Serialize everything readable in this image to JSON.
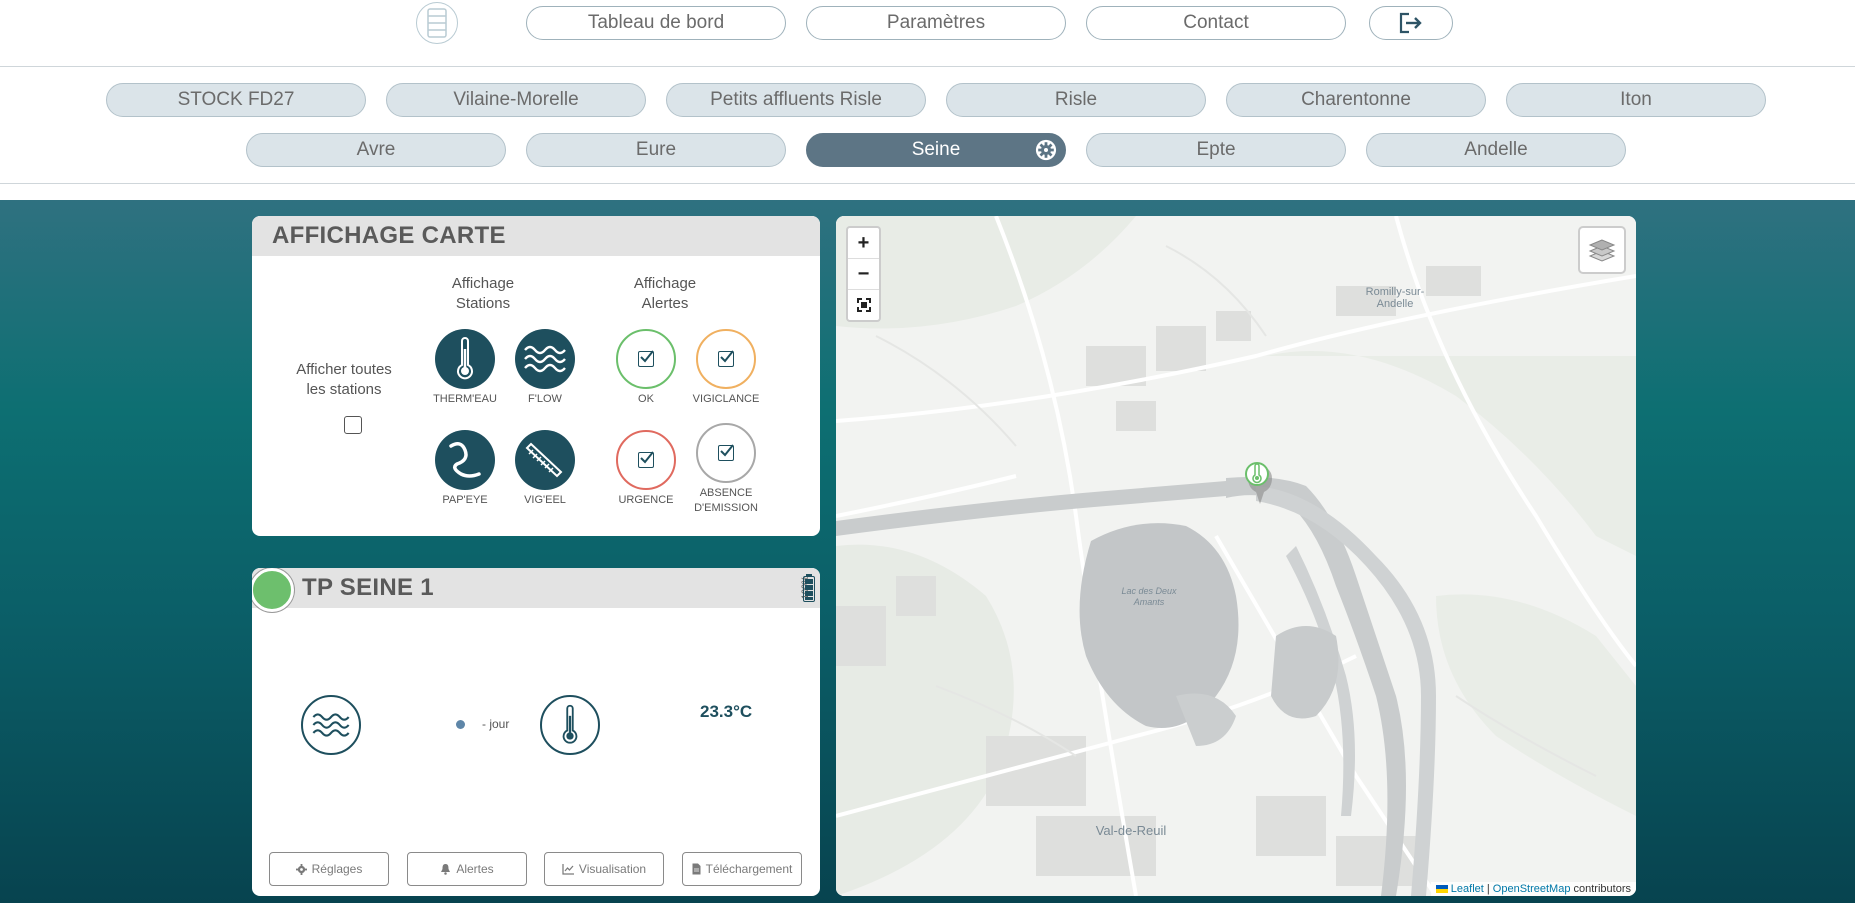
{
  "nav": {
    "dashboard": "Tableau de bord",
    "settings": "Paramètres",
    "contact": "Contact"
  },
  "rivers": {
    "row1": [
      "STOCK FD27",
      "Vilaine-Morelle",
      "Petits affluents Risle",
      "Risle",
      "Charentonne",
      "Iton"
    ],
    "row2": [
      "Avre",
      "Eure",
      "Seine",
      "Epte",
      "Andelle"
    ],
    "active": "Seine"
  },
  "display_panel": {
    "title": "AFFICHAGE CARTE",
    "show_all_label": "Afficher toutes les stations",
    "stations_header": "Affichage Stations",
    "alerts_header": "Affichage Alertes",
    "stations": [
      "THERM'EAU",
      "F'LOW",
      "PAP'EYE",
      "VIG'EEL"
    ],
    "alerts": [
      "OK",
      "VIGICLANCE",
      "URGENCE",
      "ABSENCE D'EMISSION"
    ],
    "alert_colors": {
      "ok": "#6bbf6b",
      "vigilance": "#f0b060",
      "urgence": "#e06a5f",
      "absence": "#a8a8a8"
    }
  },
  "station_panel": {
    "name": "TP SEINE 1",
    "battery": "100%",
    "status_color": "#6dbf6d",
    "flow_text": "- jour",
    "temperature": "23.3°C",
    "buttons": {
      "settings": "Réglages",
      "alerts": "Alertes",
      "visualisation": "Visualisation",
      "download": "Téléchargement"
    }
  },
  "map": {
    "zoom_in": "+",
    "zoom_out": "−",
    "places": {
      "romilly_1": "Romilly-sur-",
      "romilly_2": "Andelle",
      "lac_1": "Lac des Deux",
      "lac_2": "Amants",
      "val_de_reuil": "Val-de-Reuil"
    },
    "attribution": {
      "leaflet": "Leaflet",
      "sep": "|",
      "osm": "OpenStreetMap",
      "contributors": "contributors"
    }
  },
  "colors": {
    "teal_dark": "#1e4f5e",
    "active_tab": "#5d7585",
    "tab_bg": "#dbe4e9"
  }
}
